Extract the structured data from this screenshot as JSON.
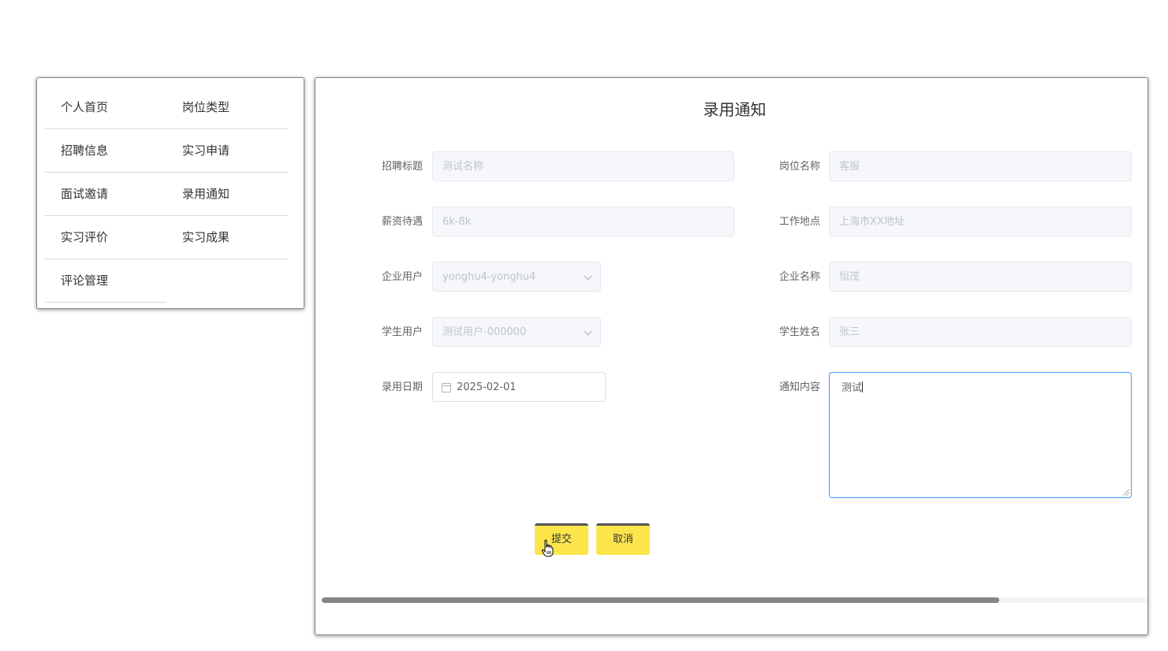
{
  "menu": {
    "items": [
      {
        "label": "个人首页"
      },
      {
        "label": "岗位类型"
      },
      {
        "label": "招聘信息"
      },
      {
        "label": "实习申请"
      },
      {
        "label": "面试邀请"
      },
      {
        "label": "录用通知"
      },
      {
        "label": "实习评价"
      },
      {
        "label": "实习成果"
      },
      {
        "label": "评论管理"
      }
    ]
  },
  "form": {
    "title": "录用通知",
    "fields": {
      "recruit_title": {
        "label": "招聘标题",
        "value": "测试名称"
      },
      "position_name": {
        "label": "岗位名称",
        "value": "客服"
      },
      "salary": {
        "label": "薪资待遇",
        "value": "6k-8k"
      },
      "work_location": {
        "label": "工作地点",
        "value": "上海市XX地址"
      },
      "company_user": {
        "label": "企业用户",
        "value": "yonghu4-yonghu4"
      },
      "company_name": {
        "label": "企业名称",
        "value": "恒茂"
      },
      "student_user": {
        "label": "学生用户",
        "value": "测试用户-000000"
      },
      "student_name": {
        "label": "学生姓名",
        "value": "张三"
      },
      "hire_date": {
        "label": "录用日期",
        "value": "2025-02-01"
      },
      "notice_content": {
        "label": "通知内容",
        "value": "测试"
      }
    },
    "buttons": {
      "submit": "提交",
      "cancel": "取消"
    }
  },
  "colors": {
    "button_bg": "#fde54c",
    "focus_border": "#409eff"
  },
  "icons": {
    "date": "calendar-icon",
    "select": "chevron-down-icon",
    "pointer": "hand-cursor-icon"
  },
  "scroll": {
    "horizontal_thumb_fraction": 0.82
  }
}
